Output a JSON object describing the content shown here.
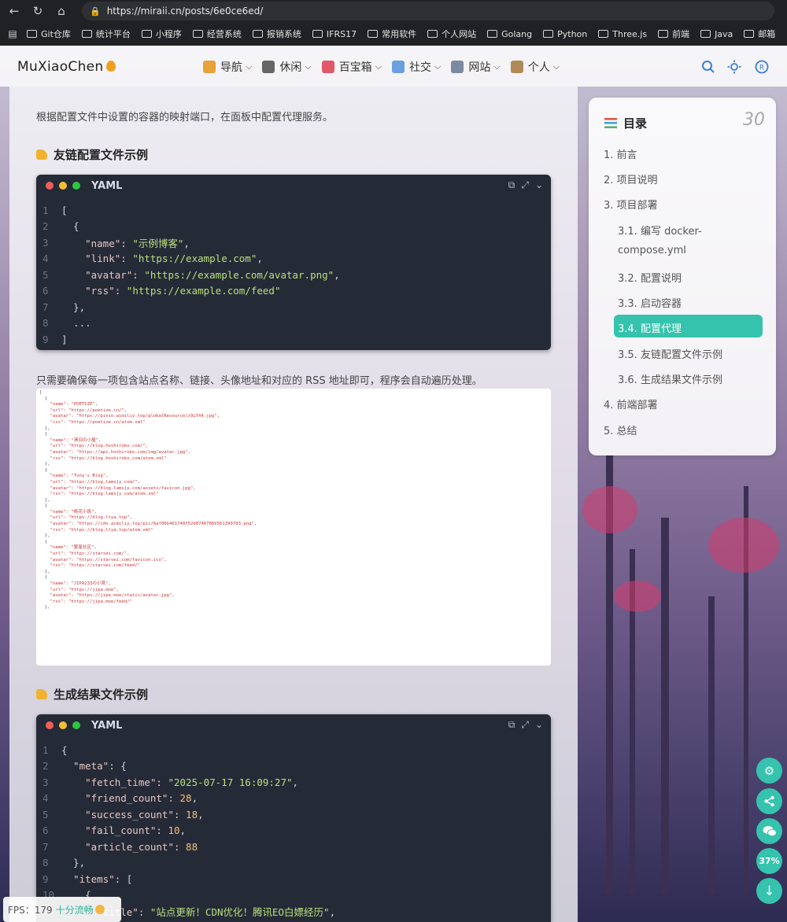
{
  "browser": {
    "url": "https://miraii.cn/posts/6e0ce6ed/",
    "bookmarks": [
      "Git仓库",
      "统计平台",
      "小程序",
      "经营系统",
      "报销系统",
      "IFRS17",
      "常用软件",
      "个人网站",
      "Golang",
      "Python",
      "Three.js",
      "前端",
      "Java",
      "邮箱"
    ]
  },
  "site": {
    "logo": "MuXiaoChen",
    "menu": [
      {
        "label": "导航",
        "color": "#e7a23a"
      },
      {
        "label": "休闲",
        "color": "#666666"
      },
      {
        "label": "百宝箱",
        "color": "#e0596a"
      },
      {
        "label": "社交",
        "color": "#6a9fe0"
      },
      {
        "label": "网站",
        "color": "#7a8aa0"
      },
      {
        "label": "个人",
        "color": "#b08a5a"
      }
    ]
  },
  "article": {
    "intro": "根据配置文件中设置的容器的映射端口，在面板中配置代理服务。",
    "heading1": "友链配置文件示例",
    "code1_lang": "YAML",
    "code1_lines": [
      {
        "n": "1",
        "t": "["
      },
      {
        "n": "2",
        "t": "  {"
      },
      {
        "n": "3",
        "k": "    \"name\": ",
        "v": "\"示例博客\"",
        "e": ","
      },
      {
        "n": "4",
        "k": "    \"link\": ",
        "v": "\"https://example.com\"",
        "e": ","
      },
      {
        "n": "5",
        "k": "    \"avatar\": ",
        "v": "\"https://example.com/avatar.png\"",
        "e": ","
      },
      {
        "n": "6",
        "k": "    \"rss\": ",
        "v": "\"https://example.com/feed\"",
        "e": ""
      },
      {
        "n": "7",
        "t": "  },"
      },
      {
        "n": "8",
        "t": "  ..."
      },
      {
        "n": "9",
        "t": "]"
      }
    ],
    "note": "只需要确保每一项包含站点名称、链接、头像地址和对应的 RSS 地址即可，程序会自动遍历处理。",
    "screenshot_lines": [
      "[",
      "  {",
      "    \"name\": \"POETIZE\",",
      "    \"url\": \"https://poetize.cn/\",",
      "    \"avatar\": \"https://pinio.aimiliy.top/globalResource/z9LYX4.jpg\",",
      "    \"rss\": \"https://poetize.cn/atom.xml\"",
      "  },",
      "  {",
      "    \"name\": \"清羽の小屋\",",
      "    \"url\": \"https://blog.hoshiroko.com/\",",
      "    \"avatar\": \"https://api.hoshiroko.com/img/avatar.jpg\",",
      "    \"rss\": \"https://blog.hoshiroko.com/atom.xml\"",
      "  },",
      "  {",
      "    \"name\": \"Tony's Blog\",",
      "    \"url\": \"https://blog.lamsjy.com/\",",
      "    \"avatar\": \"https://blog.lamsjy.com/assets/favicon.jpg\",",
      "    \"rss\": \"https://blog.lamsjy.com/atom.xml\"",
      "  },",
      "  {",
      "    \"name\": \"桃花小筑\",",
      "    \"url\": \"https://blog.ltya.top\",",
      "    \"avatar\": \"https://cdn.aimiliy.top/pic/6af06b461740f52b0746706b561399703.png\",",
      "    \"rss\": \"https://blog.ltya.top/atom.xml\"",
      "  },",
      "  {",
      "    \"name\": \"繁星社区\",",
      "    \"url\": \"https://starsei.com/\",",
      "    \"avatar\": \"https://starsei.com/favicon.ico\",",
      "    \"rss\": \"https://starsei.com/feed/\"",
      "  },",
      "  {",
      "    \"name\": \"JIPA233の小窝\",",
      "    \"url\": \"https://jipa.moe\",",
      "    \"avatar\": \"https://jipa.moe/static/avatar.jpg\",",
      "    \"rss\": \"https://jipa.moe/feed/\"",
      "  },"
    ],
    "heading2": "生成结果文件示例",
    "code2_lang": "YAML",
    "code2_lines": [
      {
        "n": "1",
        "t": "{"
      },
      {
        "n": "2",
        "k": "  \"meta\": ",
        "e": "{"
      },
      {
        "n": "3",
        "k": "    \"fetch_time\": ",
        "v": "\"2025-07-17 16:09:27\"",
        "e": ","
      },
      {
        "n": "4",
        "k": "    \"friend_count\": ",
        "num": "28",
        "e": ","
      },
      {
        "n": "5",
        "k": "    \"success_count\": ",
        "num": "18",
        "e": ","
      },
      {
        "n": "6",
        "k": "    \"fail_count\": ",
        "num": "10",
        "e": ","
      },
      {
        "n": "7",
        "k": "    \"article_count\": ",
        "num": "88",
        "e": ""
      },
      {
        "n": "8",
        "t": "  },"
      },
      {
        "n": "9",
        "k": "  \"items\": ",
        "e": "["
      },
      {
        "n": "10",
        "t": "    {"
      },
      {
        "n": "11",
        "k": "      \"title\": ",
        "v": "\"站点更新！CDN优化！腾讯EO白嫖经历\"",
        "e": ","
      }
    ]
  },
  "toc": {
    "title": "目录",
    "count": "30",
    "items": [
      {
        "label": "1. 前言",
        "level": "top"
      },
      {
        "label": "2. 项目说明",
        "level": "top"
      },
      {
        "label": "3. 项目部署",
        "level": "top"
      },
      {
        "label": "3.1. 编写 docker-",
        "level": "sub"
      },
      {
        "label": "compose.yml",
        "level": "sub"
      },
      {
        "label": "3.2. 配置说明",
        "level": "sub"
      },
      {
        "label": "3.3. 启动容器",
        "level": "sub"
      },
      {
        "label": "3.4. 配置代理",
        "level": "sub",
        "active": true
      },
      {
        "label": "3.5. 友链配置文件示例",
        "level": "sub"
      },
      {
        "label": "3.6. 生成结果文件示例",
        "level": "sub"
      },
      {
        "label": "4. 前端部署",
        "level": "top"
      },
      {
        "label": "5. 总结",
        "level": "top"
      }
    ]
  },
  "fabs": {
    "percent": "37%"
  },
  "fps": {
    "label": "FPS：179",
    "status": "十分流畅"
  }
}
